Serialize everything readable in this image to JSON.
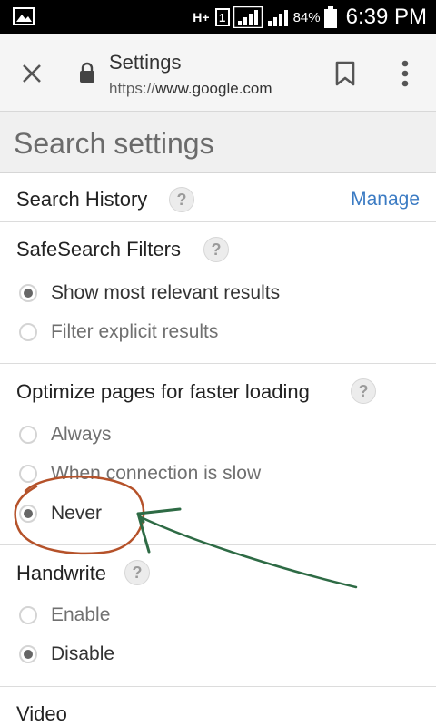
{
  "status_bar": {
    "network": "H+",
    "sim": "1",
    "battery": "84%",
    "time": "6:39 PM"
  },
  "toolbar": {
    "title": "Settings",
    "url_scheme": "https://",
    "url_host": "www.google.com",
    "icons": [
      "close-icon",
      "lock-icon",
      "bookmark-icon",
      "more-vert-icon"
    ]
  },
  "page": {
    "title": "Search settings"
  },
  "search_history": {
    "label": "Search History",
    "help": "?",
    "manage_label": "Manage"
  },
  "safesearch": {
    "label": "SafeSearch Filters",
    "help": "?",
    "options": [
      {
        "label": "Show most relevant results",
        "selected": true
      },
      {
        "label": "Filter explicit results",
        "selected": false
      }
    ]
  },
  "optimize": {
    "label": "Optimize pages for faster loading",
    "help": "?",
    "options": [
      {
        "label": "Always",
        "selected": false
      },
      {
        "label": "When connection is slow",
        "selected": false
      },
      {
        "label": "Never",
        "selected": true
      }
    ]
  },
  "handwrite": {
    "label": "Handwrite",
    "help": "?",
    "options": [
      {
        "label": "Enable",
        "selected": false
      },
      {
        "label": "Disable",
        "selected": true
      }
    ]
  },
  "video": {
    "label": "Video"
  },
  "annotation": {
    "circle_color": "#b5522a",
    "arrow_color": "#2e6b45"
  }
}
